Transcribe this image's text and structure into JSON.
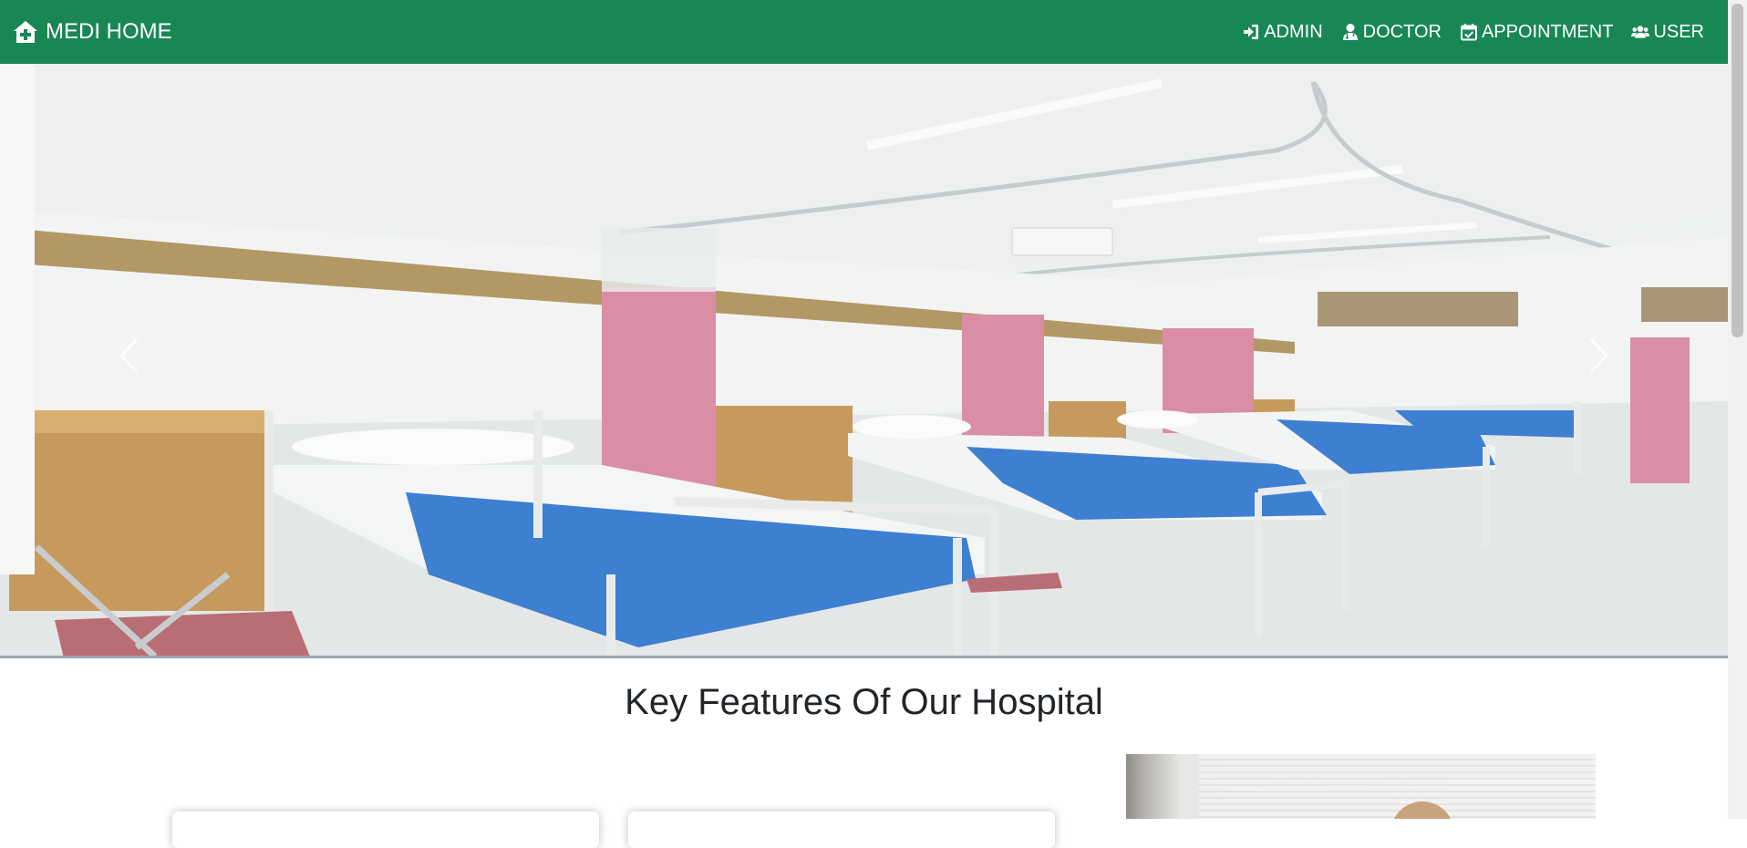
{
  "brand": {
    "label": "MEDI HOME",
    "icon": "house-medical-icon"
  },
  "nav": [
    {
      "label": "ADMIN",
      "icon": "sign-in-icon"
    },
    {
      "label": "DOCTOR",
      "icon": "user-doctor-icon"
    },
    {
      "label": "APPOINTMENT",
      "icon": "calendar-check-icon"
    },
    {
      "label": "USER",
      "icon": "users-icon"
    }
  ],
  "hero": {
    "image": "hospital-ward-photo",
    "prev_icon": "chevron-left-icon",
    "next_icon": "chevron-right-icon"
  },
  "features": {
    "title": "Key Features Of Our Hospital"
  },
  "colors": {
    "navbar": "#198754",
    "text": "#212529",
    "white": "#ffffff"
  }
}
